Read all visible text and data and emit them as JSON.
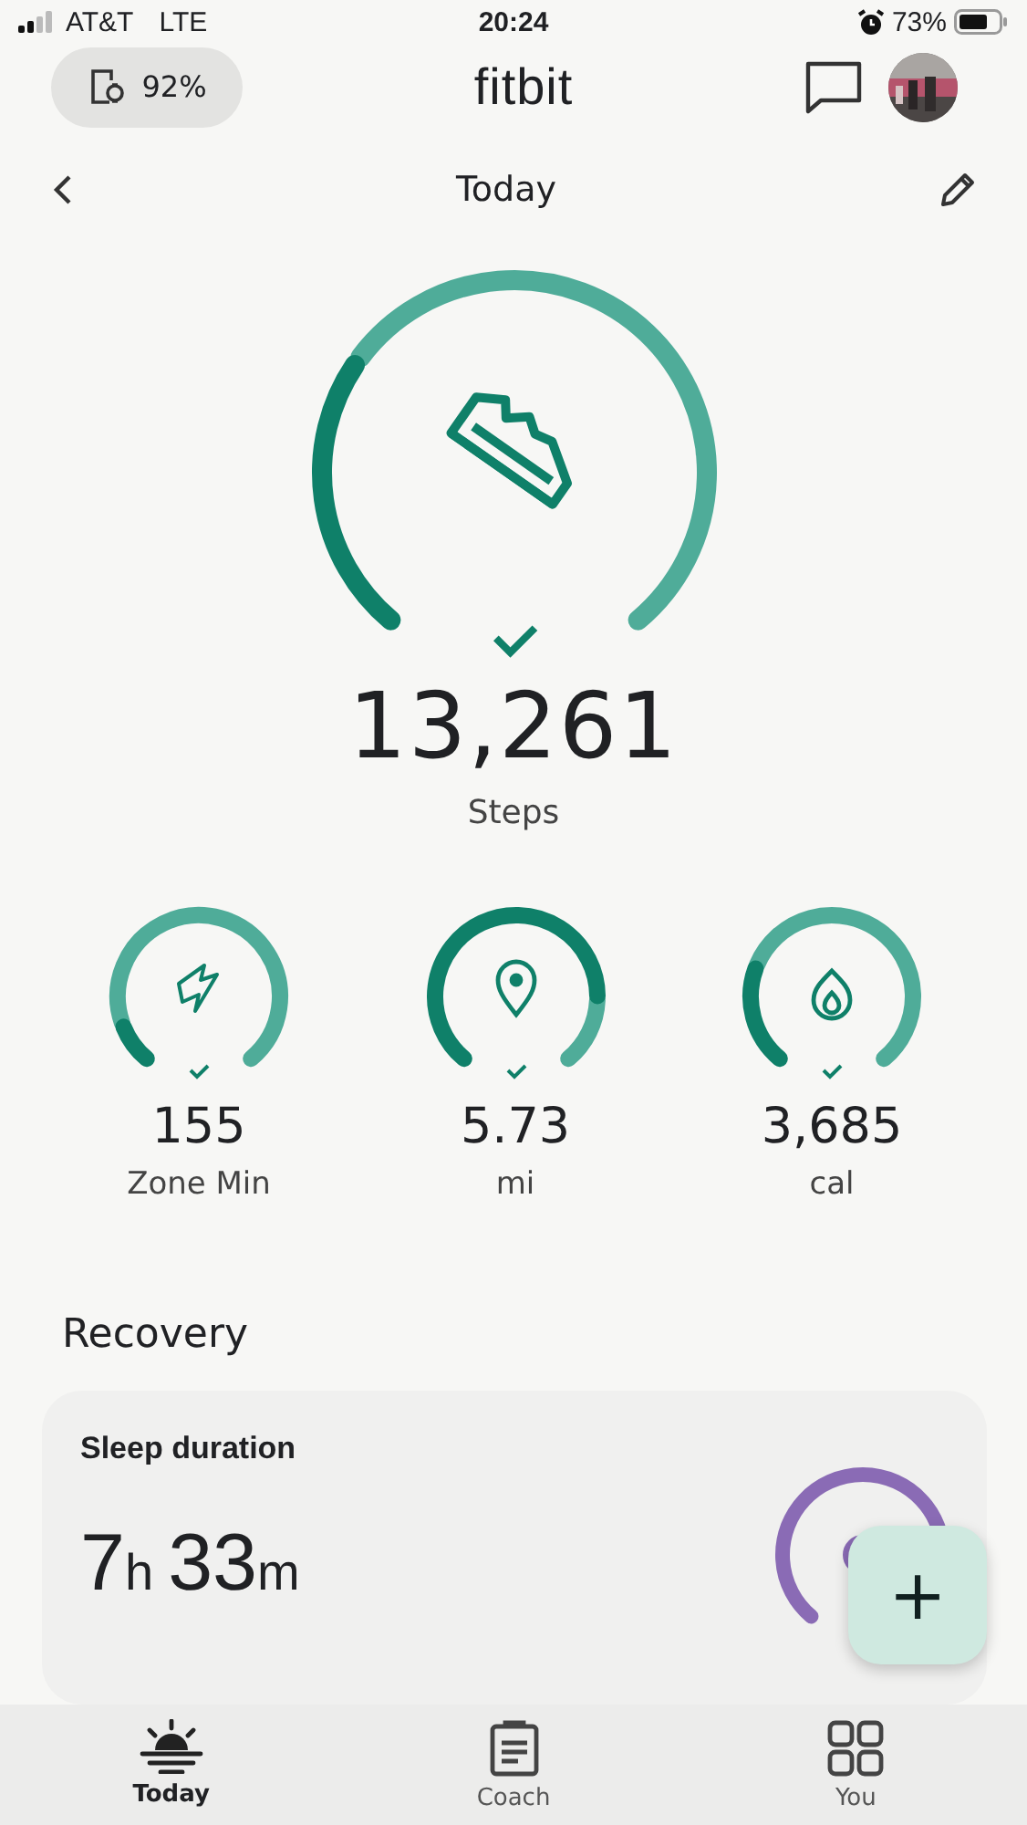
{
  "status_bar": {
    "carrier": "AT&T",
    "network": "LTE",
    "time": "20:24",
    "battery": "73%",
    "alarm": true
  },
  "header": {
    "device_battery": "92%",
    "logo": "fitbit"
  },
  "nav_row": {
    "title": "Today"
  },
  "main_stat": {
    "kind": "steps",
    "value": "13,261",
    "label": "Steps",
    "goal_met": true
  },
  "stats": [
    {
      "kind": "zone",
      "value": "155",
      "label": "Zone Min",
      "goal_met": true
    },
    {
      "kind": "distance",
      "value": "5.73",
      "label": "mi",
      "goal_met": true
    },
    {
      "kind": "calories",
      "value": "3,685",
      "label": "cal",
      "goal_met": true
    }
  ],
  "section": {
    "title": "Recovery"
  },
  "sleep_card": {
    "title": "Sleep duration",
    "hours": "7",
    "hours_unit": "h",
    "minutes": "33",
    "minutes_unit": "m"
  },
  "fab": {
    "symbol": "+"
  },
  "tabs": [
    {
      "kind": "today",
      "label": "Today",
      "selected": true
    },
    {
      "kind": "coach",
      "label": "Coach",
      "selected": false
    },
    {
      "kind": "you",
      "label": "You",
      "selected": false
    }
  ]
}
